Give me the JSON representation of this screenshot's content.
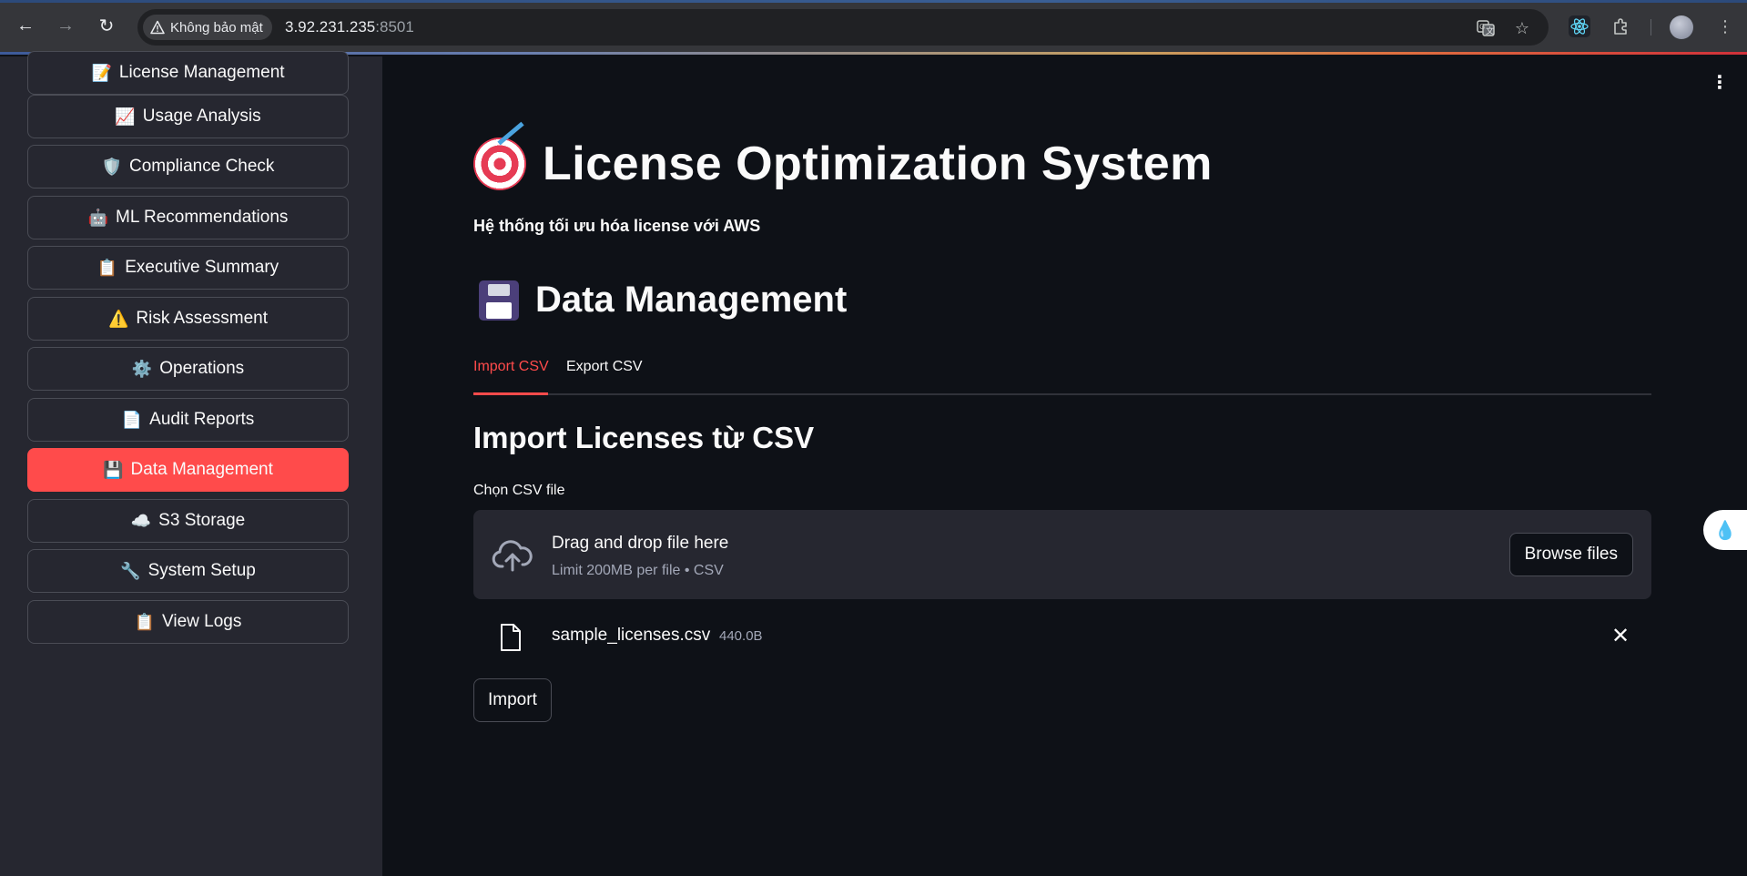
{
  "browser": {
    "security_label": "Không bảo mật",
    "url_host": "3.92.231.235",
    "url_port": ":8501"
  },
  "sidebar": {
    "items": [
      {
        "emoji": "📝",
        "label": "License Management",
        "active": false
      },
      {
        "emoji": "📈",
        "label": "Usage Analysis",
        "active": false
      },
      {
        "emoji": "🛡️",
        "label": "Compliance Check",
        "active": false
      },
      {
        "emoji": "🤖",
        "label": "ML Recommendations",
        "active": false
      },
      {
        "emoji": "📋",
        "label": "Executive Summary",
        "active": false
      },
      {
        "emoji": "⚠️",
        "label": "Risk Assessment",
        "active": false
      },
      {
        "emoji": "⚙️",
        "label": "Operations",
        "active": false
      },
      {
        "emoji": "📄",
        "label": "Audit Reports",
        "active": false
      },
      {
        "emoji": "💾",
        "label": "Data Management",
        "active": true
      },
      {
        "emoji": "☁️",
        "label": "S3 Storage",
        "active": false
      },
      {
        "emoji": "🔧",
        "label": "System Setup",
        "active": false
      },
      {
        "emoji": "📋",
        "label": "View Logs",
        "active": false
      }
    ]
  },
  "main": {
    "title": "License Optimization System",
    "subtitle": "Hệ thống tối ưu hóa license với AWS",
    "section_title": "Data Management",
    "tabs": [
      {
        "label": "Import CSV",
        "active": true
      },
      {
        "label": "Export CSV",
        "active": false
      }
    ],
    "import_heading": "Import Licenses từ CSV",
    "file_label": "Chọn CSV file",
    "dropzone": {
      "title": "Drag and drop file here",
      "limit": "Limit 200MB per file • CSV",
      "browse_label": "Browse files"
    },
    "uploaded_file": {
      "name": "sample_licenses.csv",
      "size": "440.0B"
    },
    "import_button": "Import"
  },
  "colors": {
    "accent": "#ff4b4b",
    "sidebar_bg": "#262730",
    "main_bg": "#0e1117"
  }
}
